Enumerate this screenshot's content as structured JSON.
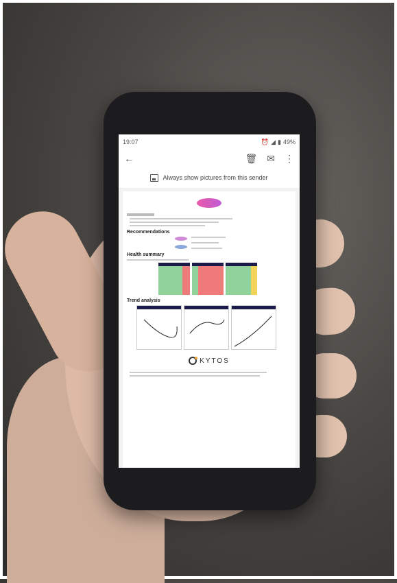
{
  "status_bar": {
    "time": "19:07",
    "battery": "49%"
  },
  "toolbar": {
    "back_icon": "arrow-left-icon",
    "delete_icon": "trash-icon",
    "mail_icon": "mail-icon",
    "more_icon": "more-vert-icon"
  },
  "banner": {
    "text": "Always show pictures from this sender"
  },
  "email": {
    "recommendations_title": "Recommendations",
    "health_title": "Health summary",
    "trend_title": "Trend analysis",
    "brand": "KYTOS"
  },
  "colors": {
    "green": "#8fd29a",
    "red": "#ef7a7a",
    "yellow": "#f3d35a",
    "navy": "#1b1b4a"
  }
}
